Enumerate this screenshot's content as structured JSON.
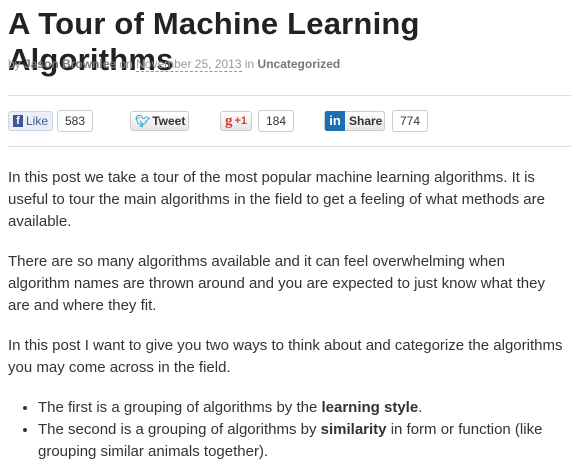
{
  "title": "A Tour of Machine Learning Algorithms",
  "meta": {
    "by": "by",
    "author": "Jason Brownlee",
    "on": "on",
    "date": "November 25, 2013",
    "in": "in",
    "category": "Uncategorized"
  },
  "social": {
    "like": "Like",
    "like_count": "583",
    "tweet": "Tweet",
    "plusone": "+1",
    "plusone_count": "184",
    "share": "Share",
    "share_count": "774"
  },
  "paragraphs": [
    "In this post we take a tour of the most popular machine learning algorithms. It is useful to tour the main algorithms in the field to get a feeling of what methods are available.",
    "There are so many algorithms available and it can feel overwhelming when algorithm names are thrown around and you are expected to just know what they are and where they fit.",
    "In this post I want to give you two ways to think about and categorize the algorithms you may come across in the field."
  ],
  "bullets": [
    {
      "pre": "The first is a grouping of algorithms by the ",
      "bold": "learning style",
      "post": "."
    },
    {
      "pre": "The second is a grouping of algorithms by ",
      "bold": "similarity",
      "post": " in form or function (like grouping similar animals together)."
    }
  ]
}
